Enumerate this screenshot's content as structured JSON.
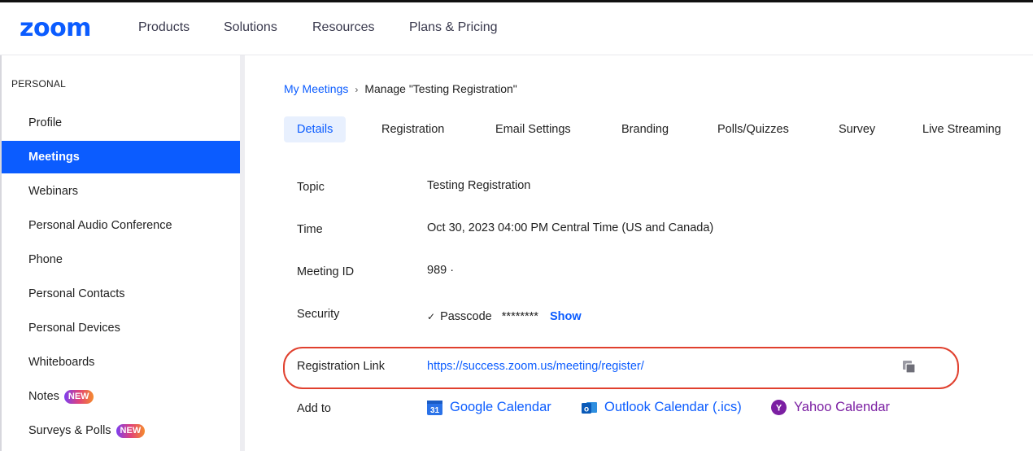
{
  "header": {
    "logo": "zoom",
    "nav": [
      "Products",
      "Solutions",
      "Resources",
      "Plans & Pricing"
    ]
  },
  "sidebar": {
    "section": "PERSONAL",
    "items": [
      {
        "label": "Profile"
      },
      {
        "label": "Meetings",
        "active": true
      },
      {
        "label": "Webinars"
      },
      {
        "label": "Personal Audio Conference"
      },
      {
        "label": "Phone"
      },
      {
        "label": "Personal Contacts"
      },
      {
        "label": "Personal Devices"
      },
      {
        "label": "Whiteboards"
      },
      {
        "label": "Notes",
        "badge": "NEW"
      },
      {
        "label": "Surveys & Polls",
        "badge": "NEW"
      }
    ]
  },
  "breadcrumb": {
    "parent": "My Meetings",
    "separator": "›",
    "current": "Manage \"Testing Registration\""
  },
  "tabs": [
    "Details",
    "Registration",
    "Email Settings",
    "Branding",
    "Polls/Quizzes",
    "Survey",
    "Live Streaming"
  ],
  "details": {
    "topic_label": "Topic",
    "topic_value": "Testing Registration",
    "time_label": "Time",
    "time_value": "Oct 30, 2023 04:00 PM Central Time (US and Canada)",
    "meeting_id_label": "Meeting ID",
    "meeting_id_value": "989 ·",
    "security_label": "Security",
    "passcode_label": "Passcode",
    "passcode_mask": "********",
    "show_label": "Show",
    "registration_label": "Registration Link",
    "registration_value": "https://success.zoom.us/meeting/register/",
    "add_to_label": "Add to",
    "calendars": [
      "Google Calendar",
      "Outlook Calendar (.ics)",
      "Yahoo Calendar"
    ]
  },
  "colors": {
    "accent": "#0b5cff",
    "highlight": "#e0402e",
    "yahoo": "#7b1fa2"
  }
}
